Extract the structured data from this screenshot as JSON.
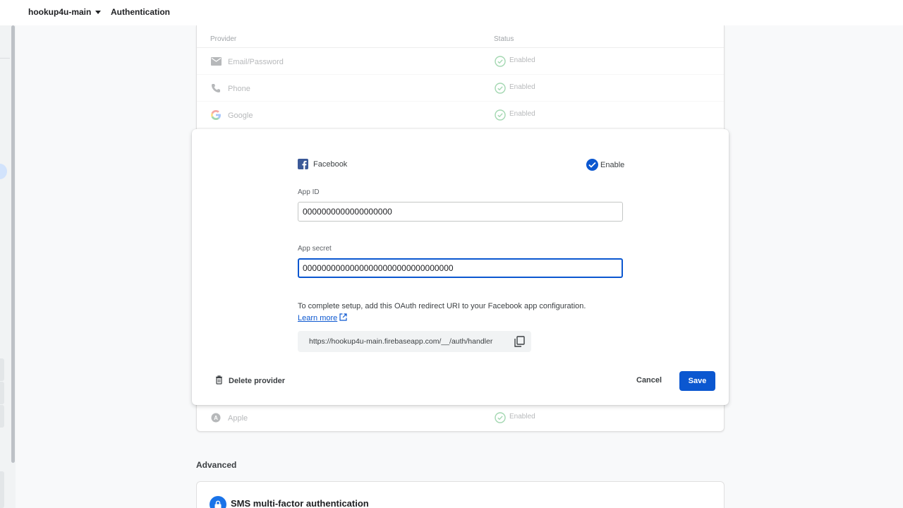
{
  "topbar": {
    "project_name": "hookup4u-main",
    "page_title": "Authentication"
  },
  "providers": {
    "header_provider": "Provider",
    "header_status": "Status",
    "rows": [
      {
        "name": "Email/Password",
        "status": "Enabled",
        "icon": "mail-icon"
      },
      {
        "name": "Phone",
        "status": "Enabled",
        "icon": "phone-icon"
      },
      {
        "name": "Google",
        "status": "Enabled",
        "icon": "google-icon"
      },
      {
        "name": "Apple",
        "status": "Enabled",
        "icon": "apple-icon"
      }
    ]
  },
  "dialog": {
    "provider_name": "Facebook",
    "enable_label": "Enable",
    "enabled": true,
    "app_id_label": "App ID",
    "app_id_value": "0000000000000000000",
    "app_secret_label": "App secret",
    "app_secret_value": "00000000000000000000000000000000",
    "help_text": "To complete setup, add this OAuth redirect URI to your Facebook app configuration.",
    "learn_more": "Learn more",
    "redirect_uri": "https://hookup4u-main.firebaseapp.com/__/auth/handler",
    "delete_label": "Delete provider",
    "cancel_label": "Cancel",
    "save_label": "Save"
  },
  "advanced": {
    "label": "Advanced",
    "sms_title": "SMS multi-factor authentication"
  },
  "colors": {
    "accent": "#0b57d0",
    "facebook": "#3b5998",
    "status_green": "#34a853"
  }
}
